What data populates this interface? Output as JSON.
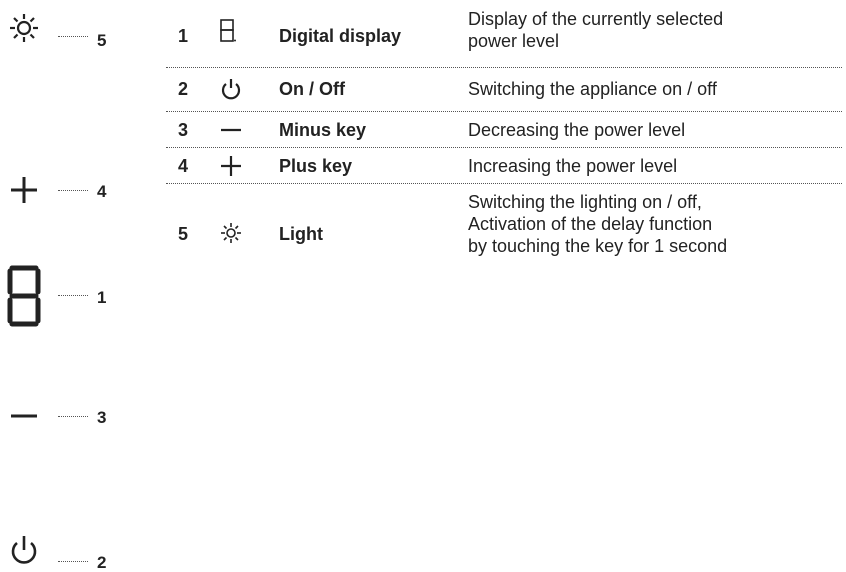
{
  "panel": {
    "controls": [
      {
        "number": "5",
        "icon": "light-icon"
      },
      {
        "number": "4",
        "icon": "plus-icon"
      },
      {
        "number": "1",
        "icon": "digital-display-icon"
      },
      {
        "number": "3",
        "icon": "minus-icon"
      },
      {
        "number": "2",
        "icon": "power-icon"
      }
    ]
  },
  "legend": {
    "rows": [
      {
        "number": "1",
        "icon": "digital-display-icon",
        "name": "Digital display",
        "description": [
          "Display of the currently selected",
          "power level"
        ]
      },
      {
        "number": "2",
        "icon": "power-icon",
        "name": "On / Off",
        "description": [
          "Switching the appliance on / off"
        ]
      },
      {
        "number": "3",
        "icon": "minus-icon",
        "name": "Minus key",
        "description": [
          "Decreasing the power level"
        ]
      },
      {
        "number": "4",
        "icon": "plus-icon",
        "name": "Plus key",
        "description": [
          "Increasing the power level"
        ]
      },
      {
        "number": "5",
        "icon": "light-icon",
        "name": "Light",
        "description": [
          "Switching the lighting on / off,",
          "Activation of the delay function",
          "by touching the key for 1 second"
        ]
      }
    ]
  }
}
